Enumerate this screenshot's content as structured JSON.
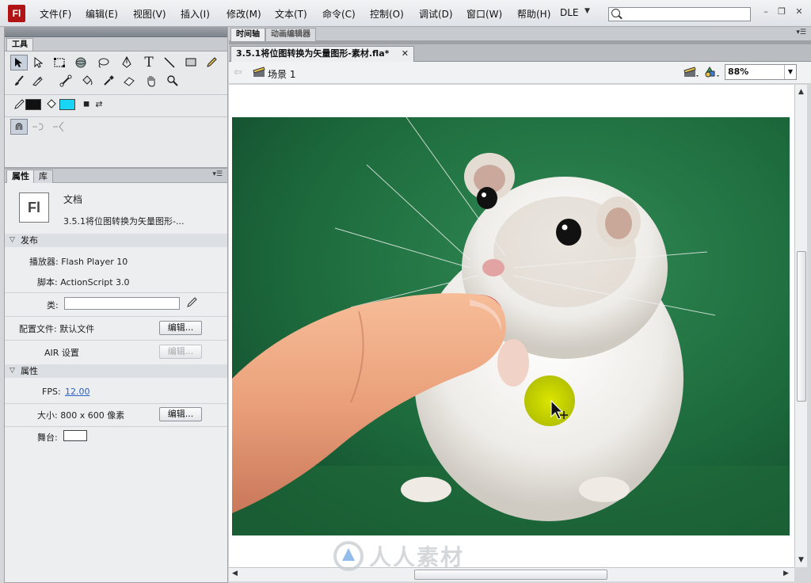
{
  "app": {
    "logo_text": "Fl",
    "colors": {
      "brand_red": "#b01414",
      "accent_cyan": "#19d5f5",
      "cursor_highlight": "#c6d400"
    }
  },
  "menu": {
    "items": [
      "文件(F)",
      "编辑(E)",
      "视图(V)",
      "插入(I)",
      "修改(M)",
      "文本(T)",
      "命令(C)",
      "控制(O)",
      "调试(D)",
      "窗口(W)",
      "帮助(H)"
    ],
    "workspace": "DLE",
    "dropdown_icon": "chevron-down-icon",
    "search_placeholder": "",
    "window_controls": [
      "minimize-icon",
      "restore-icon",
      "close-icon"
    ]
  },
  "tools_panel": {
    "tab": "工具",
    "tools": [
      "selection-icon",
      "subselection-icon",
      "free-transform-icon",
      "3d-rotation-icon",
      "lasso-icon",
      "pen-icon",
      "text-icon",
      "line-icon",
      "rectangle-icon",
      "pencil-icon",
      "brush-icon",
      "deco-icon",
      "bone-icon",
      "paint-bucket-icon",
      "eyedropper-icon",
      "eraser-icon",
      "hand-icon",
      "zoom-icon"
    ],
    "stroke_color": "#111111",
    "fill_color": "#19d5f5",
    "options": [
      "snap-to-objects-icon",
      "smooth-icon",
      "straighten-icon"
    ]
  },
  "properties_panel": {
    "tabs": [
      "属性",
      "库"
    ],
    "doc_type": "文档",
    "doc_name": "3.5.1将位图转换为矢量图形-...",
    "publish_header": "发布",
    "player_label": "播放器: Flash Player 10",
    "script_label": "脚本: ActionScript 3.0",
    "class_label": "类:",
    "class_value": "",
    "profile_label": "配置文件: 默认文件",
    "air_label": "AIR 设置",
    "edit_label": "编辑...",
    "properties_header": "属性",
    "fps_label": "FPS:",
    "fps_value": "12.00",
    "size_label": "大小: 800 x 600 像素",
    "stage_label": "舞台:",
    "stage_color": "#ffffff"
  },
  "top_tabs": [
    "时间轴",
    "动画编辑器"
  ],
  "document": {
    "tab_title": "3.5.1将位图转换为矢量图形-素材.fla*",
    "scene_label": "场景 1",
    "zoom": "88%"
  },
  "watermark": {
    "text": "人人素材"
  }
}
